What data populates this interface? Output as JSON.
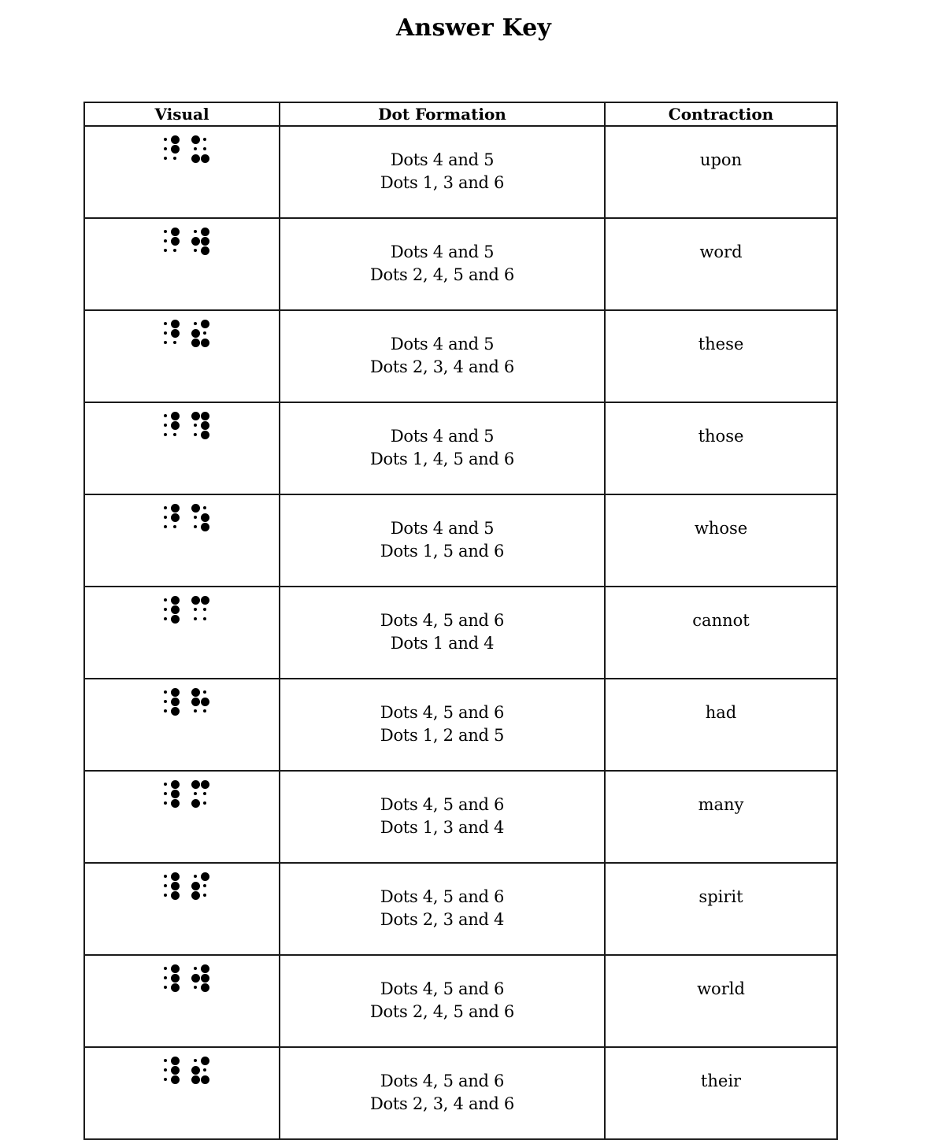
{
  "title": "Answer Key",
  "table": {
    "headers": [
      "Visual",
      "Dot Formation",
      "Contraction"
    ],
    "rows": [
      {
        "cells": [
          [
            4,
            5
          ],
          [
            1,
            3,
            6
          ]
        ],
        "formation": [
          "Dots 4 and 5",
          "Dots 1, 3 and 6"
        ],
        "contraction": "upon"
      },
      {
        "cells": [
          [
            4,
            5
          ],
          [
            2,
            4,
            5,
            6
          ]
        ],
        "formation": [
          "Dots 4 and 5",
          "Dots 2, 4, 5 and 6"
        ],
        "contraction": "word"
      },
      {
        "cells": [
          [
            4,
            5
          ],
          [
            2,
            3,
            4,
            6
          ]
        ],
        "formation": [
          "Dots 4 and 5",
          "Dots 2, 3, 4 and 6"
        ],
        "contraction": "these"
      },
      {
        "cells": [
          [
            4,
            5
          ],
          [
            1,
            4,
            5,
            6
          ]
        ],
        "formation": [
          "Dots 4 and 5",
          "Dots 1, 4, 5 and 6"
        ],
        "contraction": "those"
      },
      {
        "cells": [
          [
            4,
            5
          ],
          [
            1,
            5,
            6
          ]
        ],
        "formation": [
          "Dots 4 and 5",
          "Dots 1, 5 and 6"
        ],
        "contraction": "whose"
      },
      {
        "cells": [
          [
            4,
            5,
            6
          ],
          [
            1,
            4
          ]
        ],
        "formation": [
          "Dots 4, 5 and 6",
          "Dots 1 and 4"
        ],
        "contraction": "cannot"
      },
      {
        "cells": [
          [
            4,
            5,
            6
          ],
          [
            1,
            2,
            5
          ]
        ],
        "formation": [
          "Dots 4, 5 and 6",
          "Dots 1, 2 and 5"
        ],
        "contraction": "had"
      },
      {
        "cells": [
          [
            4,
            5,
            6
          ],
          [
            1,
            3,
            4
          ]
        ],
        "formation": [
          "Dots 4, 5 and 6",
          "Dots 1, 3 and 4"
        ],
        "contraction": "many"
      },
      {
        "cells": [
          [
            4,
            5,
            6
          ],
          [
            2,
            3,
            4
          ]
        ],
        "formation": [
          "Dots 4, 5 and 6",
          "Dots 2, 3 and 4"
        ],
        "contraction": "spirit"
      },
      {
        "cells": [
          [
            4,
            5,
            6
          ],
          [
            2,
            4,
            5,
            6
          ]
        ],
        "formation": [
          "Dots 4, 5 and 6",
          "Dots 2, 4, 5 and 6"
        ],
        "contraction": "world"
      },
      {
        "cells": [
          [
            4,
            5,
            6
          ],
          [
            2,
            3,
            4,
            6
          ]
        ],
        "formation": [
          "Dots 4, 5 and 6",
          "Dots 2, 3, 4 and 6"
        ],
        "contraction": "their"
      }
    ]
  }
}
